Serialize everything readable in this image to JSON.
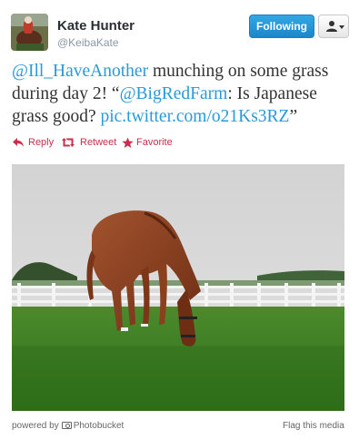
{
  "user": {
    "display_name": "Kate Hunter",
    "screen_name": "@KeibaKate"
  },
  "header": {
    "follow_label": "Following"
  },
  "tweet": {
    "mention_1": "@Ill_HaveAnother",
    "text_1": " munching on some grass during day 2! “",
    "mention_2": "@BigRedFarm",
    "text_2": ": Is Japanese grass good? ",
    "link": "pic.twitter.com/o21Ks3RZ",
    "text_3": "”"
  },
  "actions": {
    "reply": "Reply",
    "retweet": "Retweet",
    "favorite": "Favorite"
  },
  "media": {
    "powered_by_prefix": "powered by",
    "provider": "Photobucket",
    "flag": "Flag this media"
  },
  "colors": {
    "link": "#2a9ad7",
    "action": "#c8304d",
    "follow_button": "#2a9ad7"
  },
  "icons": {
    "reply": "reply-arrow-icon",
    "retweet": "retweet-icon",
    "favorite": "star-icon",
    "user_menu": "person-icon"
  }
}
